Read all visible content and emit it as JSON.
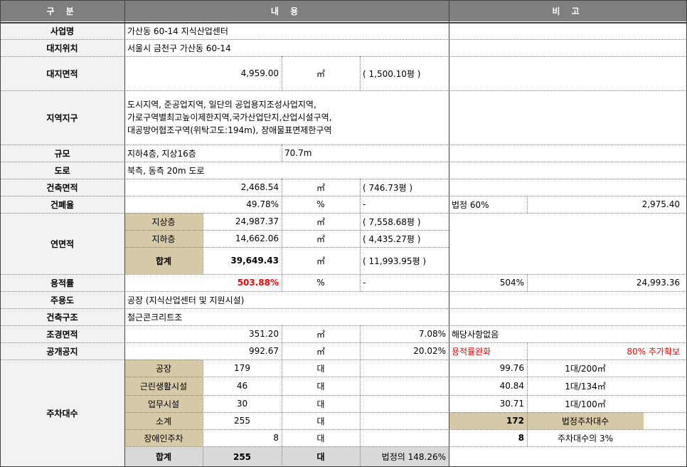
{
  "header": {
    "category": "구 분",
    "content": "내 용",
    "remarks": "비 고"
  },
  "rows": {
    "project_name": {
      "label": "사업명",
      "value": "가산동 60-14 지식산업센터"
    },
    "site_location": {
      "label": "대지위치",
      "value": "서울시 금천구 가산동 60-14"
    },
    "site_area": {
      "label": "대지면적",
      "value": "4,959.00",
      "unit": "㎡",
      "pyeong": "( 1,500.10평 )"
    },
    "zoning": {
      "label": "지역지구",
      "lines": [
        "도시지역, 준공업지역, 일단의 공업용지조성사업지역,",
        "가로구역별최고높이제한지역,국가산업단지,산업시설구역,",
        "대공방어협조구역(위탁고도:194m), 장애물표면제한구역"
      ]
    },
    "scale": {
      "label": "규모",
      "value": "지하4층, 지상16층",
      "height": "70.7m"
    },
    "road": {
      "label": "도로",
      "value": "북측, 동측 20m 도로"
    },
    "building_area": {
      "label": "건축면적",
      "value": "2,468.54",
      "unit": "㎡",
      "pyeong": "( 746.73평 )"
    },
    "coverage_ratio": {
      "label": "건폐율",
      "value": "49.78%",
      "unit": "%",
      "extra": "-",
      "remark": "법정 60%",
      "remark_value": "2,975.40"
    },
    "floor_area": {
      "label": "연면적",
      "above": {
        "label": "지상층",
        "value": "24,987.37",
        "unit": "㎡",
        "pyeong": "( 7,558.68평 )"
      },
      "below": {
        "label": "지하층",
        "value": "14,662.06",
        "unit": "㎡",
        "pyeong": "( 4,435.27평 )"
      },
      "total": {
        "label": "합계",
        "value": "39,649.43",
        "unit": "㎡",
        "pyeong": "( 11,993.95평 )"
      }
    },
    "far": {
      "label": "용적률",
      "value": "503.88%",
      "unit": "%",
      "extra": "-",
      "remark": "504%",
      "remark_value": "24,993.36"
    },
    "main_use": {
      "label": "주용도",
      "value": "공장 (지식산업센터 및 지원시설)"
    },
    "structure": {
      "label": "건축구조",
      "value": "철근콘크리트조"
    },
    "landscape": {
      "label": "조경면적",
      "value": "351.20",
      "unit": "㎡",
      "ratio": "7.08%",
      "remark": "해당사항없음"
    },
    "open_space": {
      "label": "공개공지",
      "value": "992.67",
      "unit": "㎡",
      "ratio": "20.02%",
      "remark": "용적률완화",
      "remark_value": "80% 추가확보"
    },
    "parking": {
      "label": "주차대수",
      "items": [
        {
          "label": "공장",
          "value": "179",
          "unit": "대",
          "calc": "99.76",
          "basis": "1대/200㎡"
        },
        {
          "label": "근린생활시설",
          "value": "46",
          "unit": "대",
          "calc": "40.84",
          "basis": "1대/134㎡"
        },
        {
          "label": "업무시설",
          "value": "30",
          "unit": "대",
          "calc": "30.71",
          "basis": "1대/100㎡"
        }
      ],
      "subtotal": {
        "label": "소계",
        "value": "255",
        "unit": "대",
        "calc": "172",
        "basis": "법정주차대수"
      },
      "disabled": {
        "label": "장애인주차",
        "value": "8",
        "unit": "대",
        "calc": "8",
        "basis": "주차대수의 3%"
      },
      "total": {
        "label": "합계",
        "value": "255",
        "unit": "대",
        "note": "법정의 148.26%"
      }
    }
  }
}
